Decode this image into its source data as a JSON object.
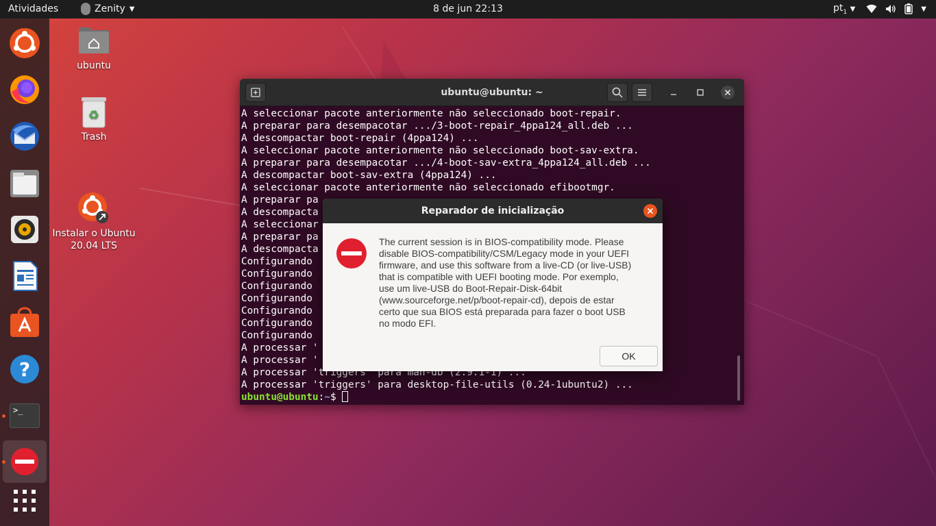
{
  "topbar": {
    "activities": "Atividades",
    "app_name": "Zenity",
    "clock": "8 de jun  22:13",
    "keyboard_layout": "pt",
    "keyboard_layout_sub": "1"
  },
  "dock": {
    "items": [
      {
        "name": "ubuntu-installer-icon"
      },
      {
        "name": "firefox-icon"
      },
      {
        "name": "thunderbird-icon"
      },
      {
        "name": "files-icon"
      },
      {
        "name": "rhythmbox-icon"
      },
      {
        "name": "libreoffice-writer-icon"
      },
      {
        "name": "ubuntu-software-icon"
      },
      {
        "name": "help-icon"
      },
      {
        "name": "terminal-icon"
      },
      {
        "name": "error-dialog-icon"
      },
      {
        "name": "show-applications-icon"
      }
    ],
    "terminal_prompt_glyph": ">_"
  },
  "desktop": {
    "icons": [
      {
        "label": "ubuntu"
      },
      {
        "label": "Trash"
      },
      {
        "label": "Instalar o Ubuntu\n20.04 LTS"
      }
    ]
  },
  "terminal": {
    "title": "ubuntu@ubuntu: ~",
    "lines": [
      "A seleccionar pacote anteriormente não seleccionado boot-repair.",
      "A preparar para desempacotar .../3-boot-repair_4ppa124_all.deb ...",
      "A descompactar boot-repair (4ppa124) ...",
      "A seleccionar pacote anteriormente não seleccionado boot-sav-extra.",
      "A preparar para desempacotar .../4-boot-sav-extra_4ppa124_all.deb ...",
      "A descompactar boot-sav-extra (4ppa124) ...",
      "A seleccionar pacote anteriormente não seleccionado efibootmgr.",
      "A preparar pa",
      "A descompacta",
      "A seleccionar",
      "A preparar pa",
      "A descompacta",
      "Configurando ",
      "Configurando ",
      "Configurando ",
      "Configurando ",
      "Configurando ",
      "Configurando ",
      "Configurando ",
      "A processar '",
      "A processar '",
      "A processar 'triggers' para man-db (2.9.1-1) ...",
      "A processar 'triggers' para desktop-file-utils (0.24-1ubuntu2) ..."
    ],
    "prompt_user": "ubuntu@ubuntu",
    "prompt_sep": ":",
    "prompt_path": "~",
    "prompt_symbol": "$ "
  },
  "dialog": {
    "title": "Reparador de inicialização",
    "message": "The current session is in BIOS-compatibility mode. Please\ndisable BIOS-compatibility/CSM/Legacy mode in your UEFI\nfirmware, and use this software from a live-CD (or live-USB)\nthat is compatible with UEFI booting mode. Por exemplo,\nuse um live-USB do Boot-Repair-Disk-64bit\n(www.sourceforge.net/p/boot-repair-cd), depois de estar\ncerto que sua BIOS está preparada para fazer o boot USB\nno modo EFI.",
    "ok_label": "OK",
    "icon": "error-icon"
  },
  "colors": {
    "accent": "#e95420",
    "terminal_bg": "#300a24",
    "prompt_user": "#8ae234",
    "prompt_path": "#729fcf",
    "error_red": "#e0202f"
  }
}
